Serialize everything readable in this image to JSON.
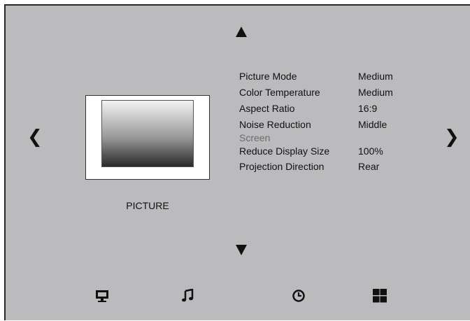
{
  "category": {
    "label": "PICTURE"
  },
  "settings": [
    {
      "label": "Picture Mode",
      "value": "Medium"
    },
    {
      "label": "Color Temperature",
      "value": "Medium"
    },
    {
      "label": "Aspect Ratio",
      "value": "16:9"
    },
    {
      "label": "Noise Reduction",
      "value": "Middle"
    },
    {
      "label": "Screen",
      "value": "",
      "disabled": true
    },
    {
      "label": "Reduce Display Size",
      "value": "100%"
    },
    {
      "label": "Projection Direction",
      "value": "Rear"
    }
  ],
  "navigation": {
    "up": "up-arrow",
    "down": "down-arrow",
    "left": "left-chevron",
    "right": "right-chevron"
  },
  "bottom_icons": [
    "monitor-icon",
    "music-note-icon",
    "clock-icon",
    "grid-icon"
  ],
  "colors": {
    "background": "#bbbbbe",
    "text": "#111111",
    "disabled_text": "#6c6c6c"
  }
}
